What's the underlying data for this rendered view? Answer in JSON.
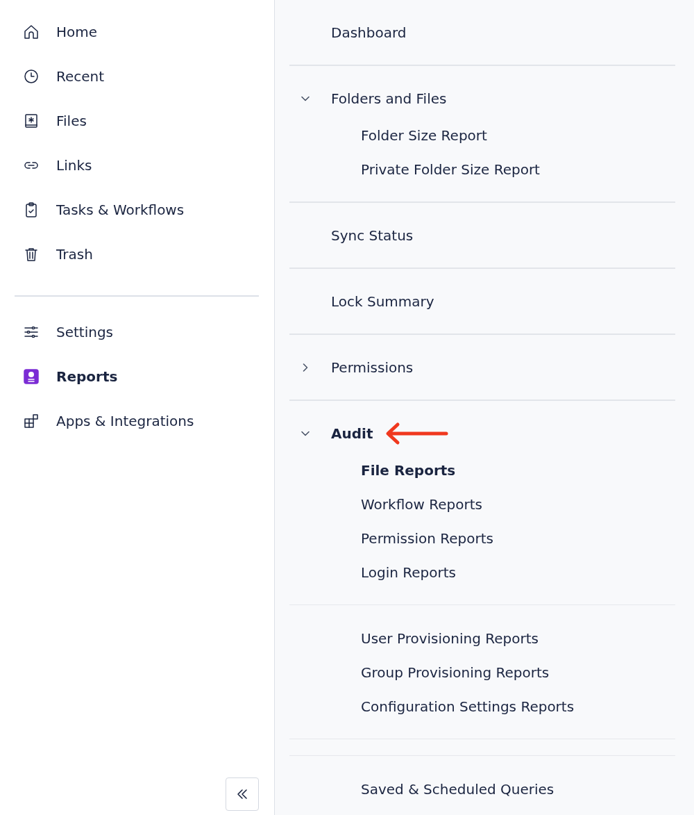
{
  "sidebar": {
    "groups": [
      {
        "items": [
          {
            "label": "Home",
            "selected": false
          },
          {
            "label": "Recent",
            "selected": false
          },
          {
            "label": "Files",
            "selected": false
          },
          {
            "label": "Links",
            "selected": false
          },
          {
            "label": "Tasks & Workflows",
            "selected": false
          },
          {
            "label": "Trash",
            "selected": false
          }
        ]
      },
      {
        "items": [
          {
            "label": "Settings",
            "selected": false
          },
          {
            "label": "Reports",
            "selected": true
          },
          {
            "label": "Apps & Integrations",
            "selected": false
          }
        ]
      }
    ]
  },
  "reports_nav": {
    "sections": [
      {
        "label": "Dashboard",
        "selected": false
      },
      {
        "label": "Folders and Files",
        "selected": false,
        "expanded": true,
        "groups": [
          {
            "kind": "list",
            "items": [
              {
                "label": "Folder Size Report",
                "selected": false
              },
              {
                "label": "Private Folder Size Report",
                "selected": false
              }
            ]
          }
        ]
      },
      {
        "label": "Sync Status",
        "selected": false
      },
      {
        "label": "Lock Summary",
        "selected": false
      },
      {
        "label": "Permissions",
        "selected": false,
        "expanded": false
      },
      {
        "label": "Audit",
        "selected": true,
        "expanded": true,
        "annotation": {
          "kind": "arrow",
          "color": "#f0381e"
        },
        "groups": [
          {
            "kind": "list",
            "items": [
              {
                "label": "File Reports",
                "selected": true
              },
              {
                "label": "Workflow Reports",
                "selected": false
              },
              {
                "label": "Permission Reports",
                "selected": false
              },
              {
                "label": "Login Reports",
                "selected": false
              }
            ]
          },
          {
            "kind": "list",
            "items": [
              {
                "label": "User Provisioning Reports",
                "selected": false
              },
              {
                "label": "Group Provisioning Reports",
                "selected": false
              },
              {
                "label": "Configuration Settings Reports",
                "selected": false
              }
            ]
          },
          {
            "kind": "footer",
            "items": [
              {
                "label": "Saved & Scheduled Queries",
                "selected": false
              }
            ]
          }
        ]
      }
    ]
  }
}
